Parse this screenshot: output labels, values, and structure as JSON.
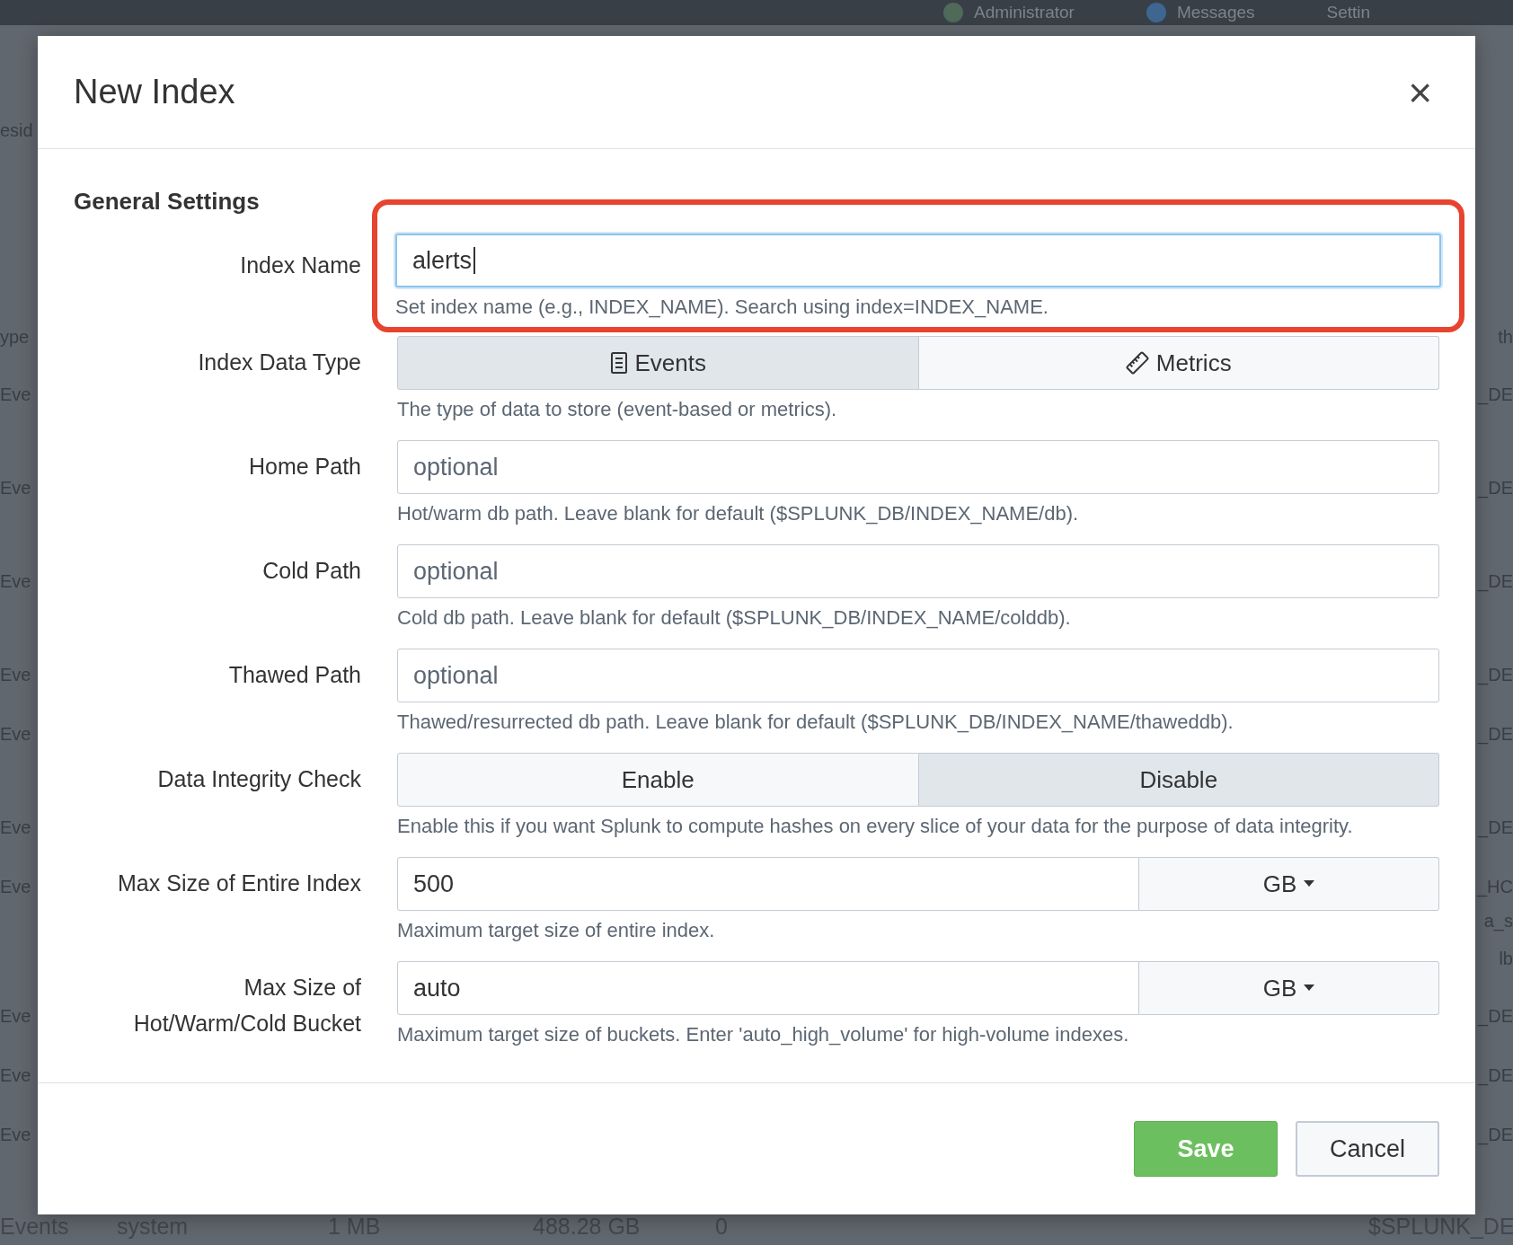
{
  "background": {
    "top_bar": [
      {
        "label": "Administrator"
      },
      {
        "label": "Messages"
      },
      {
        "label": "Settin"
      }
    ],
    "left_column": [
      "esid",
      "ype",
      "Eve",
      "Eve",
      "Eve",
      "Eve",
      "Eve",
      "Eve",
      "Eve",
      "Eve",
      "Eve",
      "Eve"
    ],
    "right_column": [
      "th",
      "_DE",
      "_DE",
      "_DE",
      "_DE",
      "_DE",
      "_DE",
      "_HC",
      "a_s",
      "lb",
      "_DE",
      "_DE",
      "_DE"
    ],
    "bottom_row": [
      "Events",
      "system",
      "1 MB",
      "488.28 GB",
      "0",
      "$SPLUNK_DE"
    ]
  },
  "dialog": {
    "title": "New Index",
    "close": "×",
    "section": "General Settings",
    "fields": [
      {
        "kind": "text",
        "label": "Index Name",
        "value": "alerts",
        "focused": true,
        "highlighted": true,
        "help": "Set index name (e.g., INDEX_NAME). Search using index=INDEX_NAME."
      },
      {
        "kind": "toggle",
        "label": "Index Data Type",
        "with_icons": true,
        "options": [
          {
            "label": "Events",
            "selected": true
          },
          {
            "label": "Metrics",
            "selected": false
          }
        ],
        "help": "The type of data to store (event-based or metrics)."
      },
      {
        "kind": "text",
        "label": "Home Path",
        "placeholder": "optional",
        "focused": false,
        "highlighted": false,
        "help": "Hot/warm db path. Leave blank for default ($SPLUNK_DB/INDEX_NAME/db)."
      },
      {
        "kind": "text",
        "label": "Cold Path",
        "placeholder": "optional",
        "focused": false,
        "highlighted": false,
        "help": "Cold db path. Leave blank for default ($SPLUNK_DB/INDEX_NAME/colddb)."
      },
      {
        "kind": "text",
        "label": "Thawed Path",
        "placeholder": "optional",
        "focused": false,
        "highlighted": false,
        "help": "Thawed/resurrected db path. Leave blank for default ($SPLUNK_DB/INDEX_NAME/thaweddb)."
      },
      {
        "kind": "toggle",
        "label": "Data Integrity Check",
        "with_icons": false,
        "options": [
          {
            "label": "Enable",
            "selected": false
          },
          {
            "label": "Disable",
            "selected": true
          }
        ],
        "help": "Enable this if you want Splunk to compute hashes on every slice of your data for the purpose of data integrity."
      },
      {
        "kind": "size",
        "label": "Max Size of Entire Index",
        "value": "500",
        "unit": "GB",
        "help": "Maximum target size of entire index."
      },
      {
        "kind": "size",
        "label": "Max Size of\nHot/Warm/Cold Bucket",
        "value": "auto",
        "unit": "GB",
        "help": "Maximum target size of buckets. Enter 'auto_high_volume' for high-volume indexes."
      }
    ],
    "buttons": [
      {
        "kind": "primary",
        "label": "Save"
      },
      {
        "kind": "secondary",
        "label": "Cancel"
      }
    ]
  }
}
